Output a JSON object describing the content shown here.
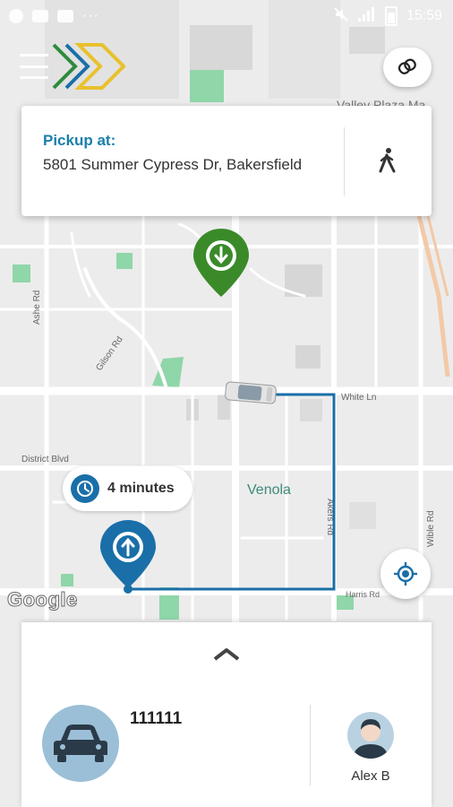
{
  "status_bar": {
    "time": "15:59",
    "dots": "···"
  },
  "header": {
    "menu_icon": "hamburger-menu-icon",
    "logo": "chevron-logo",
    "layers_icon": "layers-icon"
  },
  "pickup": {
    "title": "Pickup at:",
    "address": "5801 Summer Cypress Dr, Bakersfield",
    "walk_icon": "walking-person-icon"
  },
  "map": {
    "labels": {
      "valley_plaza": "Valley Plaza Ma",
      "white_ln": "White Ln",
      "district_blvd": "District Blvd",
      "venola": "Venola",
      "harris_rd": "Harris Rd",
      "wible_rd": "Wible Rd",
      "ashe_rd": "Ashe Rd",
      "akers_rd": "Akers Rd",
      "gilson_rd": "Gilson Rd"
    },
    "attribution": "Google",
    "route_color": "#1a6fa8",
    "pickup_pin_color": "#3a8a2a",
    "driver_pin_color": "#1a6fa8"
  },
  "eta": {
    "text": "4 minutes",
    "icon": "clock-icon"
  },
  "locate_icon": "my-location-icon",
  "bottom_sheet": {
    "expand_icon": "chevron-up-icon",
    "vehicle_number": "111111",
    "vehicle_icon": "car-icon",
    "driver_name": "Alex B",
    "driver_icon": "driver-avatar-icon"
  }
}
